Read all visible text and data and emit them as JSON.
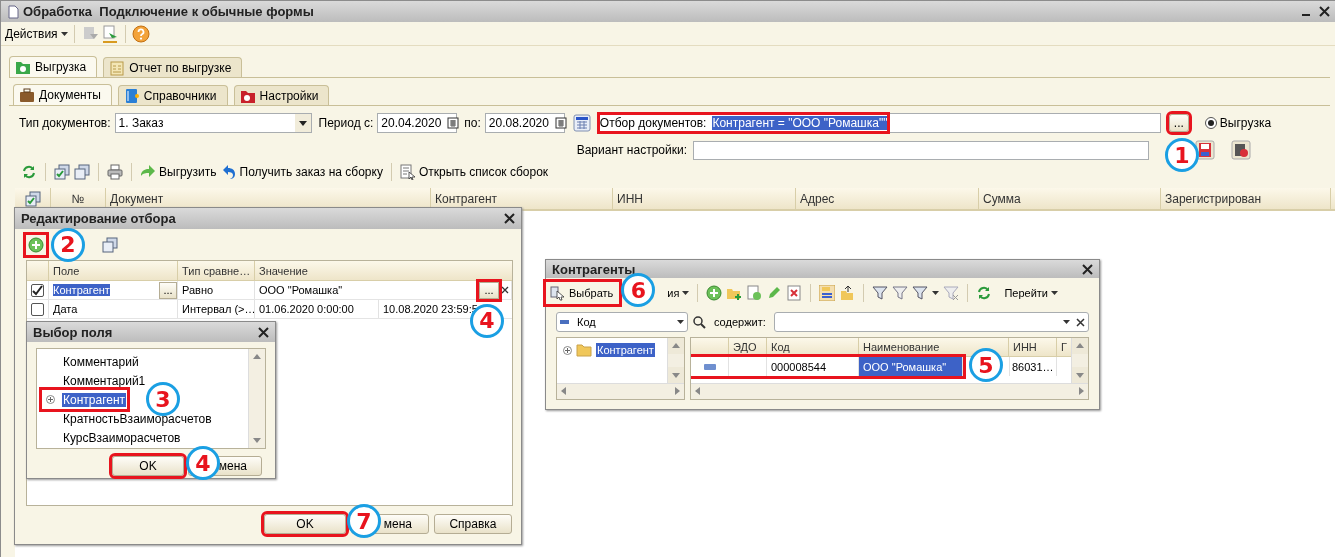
{
  "window": {
    "title": "Обработка  Подключение к обычные формы"
  },
  "toolbar": {
    "actions_label": "Действия"
  },
  "main_tabs": [
    {
      "label": "Выгрузка",
      "selected": true
    },
    {
      "label": "Отчет по выгрузке",
      "selected": false
    }
  ],
  "sub_tabs": [
    {
      "label": "Документы",
      "selected": true
    },
    {
      "label": "Справочники",
      "selected": false
    },
    {
      "label": "Настройки",
      "selected": false
    }
  ],
  "filter": {
    "doc_type_label": "Тип документов:",
    "doc_type": "1. Заказ",
    "period_label": "Период с:",
    "date_from": "20.04.2020",
    "to_label": "по:",
    "date_to": "20.08.2020",
    "selection_label": "Отбор документов:",
    "selection_value": "Контрагент = \"ООО \"Ромашка\"\"",
    "selection_highlighted": true,
    "more_button": "...",
    "more_highlighted": true,
    "more_callout": "1",
    "radio_label": "Выгрузка",
    "radio_selected": true,
    "variant_label": "Вариант настройки:"
  },
  "commands": [
    {
      "label": "Выгрузить"
    },
    {
      "label": "Получить заказ на сборку"
    },
    {
      "label": "Открыть список сборок"
    }
  ],
  "table": {
    "columns": [
      "№",
      "Документ",
      "Контрагент",
      "ИНН",
      "Адрес",
      "Сумма",
      "Зарегистрирован"
    ]
  },
  "filter_dialog": {
    "title": "Редактирование отбора",
    "add_highlighted": true,
    "add_callout": "2",
    "columns": [
      "Поле",
      "Тип сравне…",
      "Значение"
    ],
    "rows": [
      {
        "checked": true,
        "selected": true,
        "field": "Контрагент",
        "field_button": "...",
        "comparison": "Равно",
        "value": "ООО \"Ромашка\"",
        "value_button": "...",
        "value_highlighted": true,
        "callout": "4"
      },
      {
        "checked": false,
        "selected": false,
        "field": "Дата",
        "comparison": "Интервал (>…",
        "value": "01.06.2020 0:00:00",
        "value_2": "10.08.2020 23:59:5"
      }
    ],
    "buttons": [
      {
        "label": "OK",
        "highlighted": true,
        "callout": "7"
      },
      {
        "label": "мена",
        "highlighted": false
      },
      {
        "label": "Справка",
        "highlighted": false
      }
    ]
  },
  "field_dialog": {
    "title": "Выбор поля",
    "items": [
      {
        "label": "Комментарий",
        "expandable": false,
        "selected": false,
        "highlighted": false
      },
      {
        "label": "Комментарий1",
        "expandable": false,
        "selected": false,
        "highlighted": false
      },
      {
        "label": "Контрагент",
        "expandable": true,
        "selected": true,
        "highlighted": true,
        "callout": "3"
      },
      {
        "label": "КратностьВзаиморасчетов",
        "expandable": false,
        "selected": false,
        "highlighted": false
      },
      {
        "label": "КурсВзаиморасчетов",
        "expandable": false,
        "selected": false,
        "highlighted": false
      }
    ],
    "buttons": [
      {
        "label": "OK",
        "highlighted": true,
        "callout": "4"
      },
      {
        "label": "мена",
        "highlighted": false
      }
    ]
  },
  "contractor_dialog": {
    "title": "Контрагенты",
    "select_button": {
      "label": "Выбрать",
      "highlighted": true,
      "callout": "6"
    },
    "actions_label": "ия",
    "goto_label": "Перейти",
    "search_field": "Код",
    "contains_label": "содержит:",
    "tree": [
      {
        "label": "Контрагент",
        "selected": true
      }
    ],
    "columns": [
      "ЭДО",
      "Код",
      "Наименование",
      "ИНН",
      "Г"
    ],
    "rows": [
      {
        "code": "000008544",
        "name": "ООО \"Ромашка\"",
        "inn": "86031…",
        "selected": true,
        "highlighted": true,
        "callout": "5"
      }
    ]
  }
}
